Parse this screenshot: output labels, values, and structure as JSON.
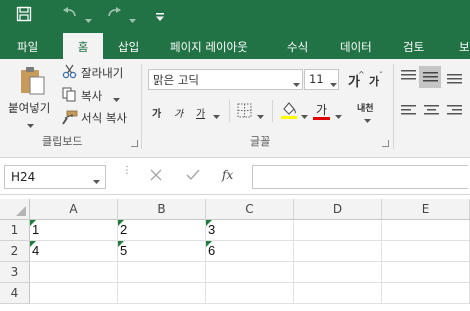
{
  "title_bar": {
    "save_icon": "save-icon",
    "undo_icon": "undo-icon",
    "redo_icon": "redo-icon",
    "customize_icon": "customize-qat-icon"
  },
  "tabs": [
    "파일",
    "홈",
    "삽입",
    "페이지 레이아웃",
    "수식",
    "데이터",
    "검토",
    "보"
  ],
  "active_tab": "홈",
  "ribbon": {
    "clipboard": {
      "paste": "붙여넣기",
      "cut": "잘라내기",
      "copy": "복사",
      "format_painter": "서식 복사",
      "group_label": "클립보드"
    },
    "font": {
      "font_name": "맑은 고딕",
      "font_size": "11",
      "grow": "가",
      "shrink": "가",
      "bold": "가",
      "italic": "가",
      "underline": "가",
      "font_color": "가",
      "phonetic": "내천",
      "group_label": "글꼴"
    }
  },
  "formula_bar": {
    "name_box": "H24",
    "cancel_icon": "cancel-icon",
    "enter_icon": "enter-icon",
    "fx": "fx",
    "formula": ""
  },
  "sheet": {
    "columns": [
      "A",
      "B",
      "C",
      "D",
      "E"
    ],
    "rows": [
      "1",
      "2",
      "3",
      "4"
    ],
    "cells": [
      [
        "1",
        "2",
        "3",
        "",
        ""
      ],
      [
        "4",
        "5",
        "6",
        "",
        ""
      ],
      [
        "",
        "",
        "",
        "",
        ""
      ],
      [
        "",
        "",
        "",
        "",
        ""
      ]
    ]
  }
}
